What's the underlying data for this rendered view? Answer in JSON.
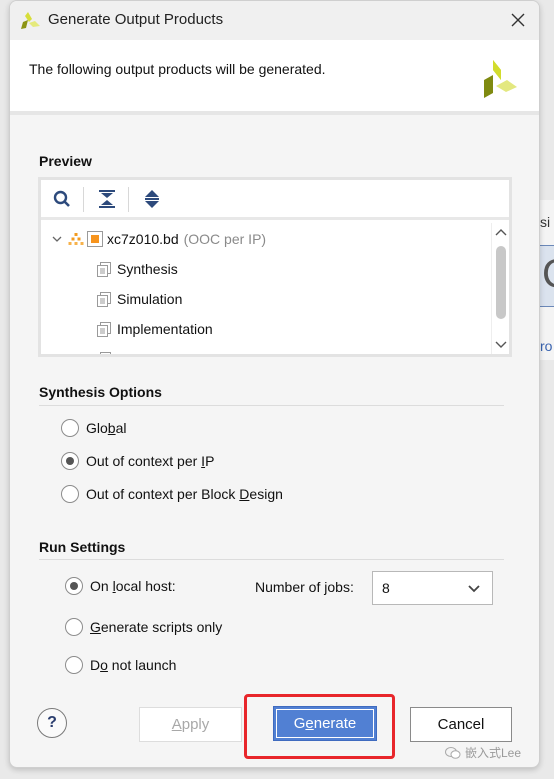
{
  "window": {
    "title": "Generate Output Products",
    "close_label": "×"
  },
  "banner": {
    "message": "The following output products will be generated."
  },
  "preview": {
    "section_title": "Preview",
    "toolbar": {
      "search_icon": "search-icon",
      "collapse_all_icon": "collapse-all-icon",
      "expand_all_icon": "expand-all-icon"
    },
    "tree": {
      "root": {
        "name": "xc7z010.bd",
        "note": "(OOC per IP)",
        "expanded": true
      },
      "children": [
        {
          "name": "Synthesis"
        },
        {
          "name": "Simulation"
        },
        {
          "name": "Implementation"
        },
        {
          "name": ""
        }
      ]
    }
  },
  "synthesis_options": {
    "section_title": "Synthesis Options",
    "options": [
      {
        "pre": "Glo",
        "mnemonic": "b",
        "post": "al",
        "checked": false
      },
      {
        "pre": "Out of context per ",
        "mnemonic": "I",
        "post": "P",
        "checked": true
      },
      {
        "pre": "Out of context per Block ",
        "mnemonic": "D",
        "post": "esign",
        "checked": false
      }
    ]
  },
  "run_settings": {
    "section_title": "Run Settings",
    "options": [
      {
        "pre": "On ",
        "mnemonic": "l",
        "post": "ocal host:",
        "checked": true
      },
      {
        "pre": "",
        "mnemonic": "G",
        "post": "enerate scripts only",
        "checked": false
      },
      {
        "pre": "D",
        "mnemonic": "o",
        "post": " not launch",
        "checked": false
      }
    ],
    "jobs": {
      "label_pre": "Number of ",
      "label_mnemonic": "j",
      "label_post": "obs:",
      "value": "8"
    }
  },
  "footer": {
    "help_label": "?",
    "apply": {
      "pre": "",
      "mnemonic": "A",
      "post": "pply",
      "enabled": false
    },
    "generate": {
      "pre": "G",
      "mnemonic": "e",
      "post": "nerate"
    },
    "cancel": {
      "label": "Cancel"
    }
  },
  "colors": {
    "primary_button": "#5180d3",
    "highlight": "#e8262b"
  },
  "watermark": {
    "text": "嵌入式Lee"
  },
  "background_window": {
    "text_fragment": "si",
    "big_fragment": "C",
    "link_fragment": "ro"
  }
}
